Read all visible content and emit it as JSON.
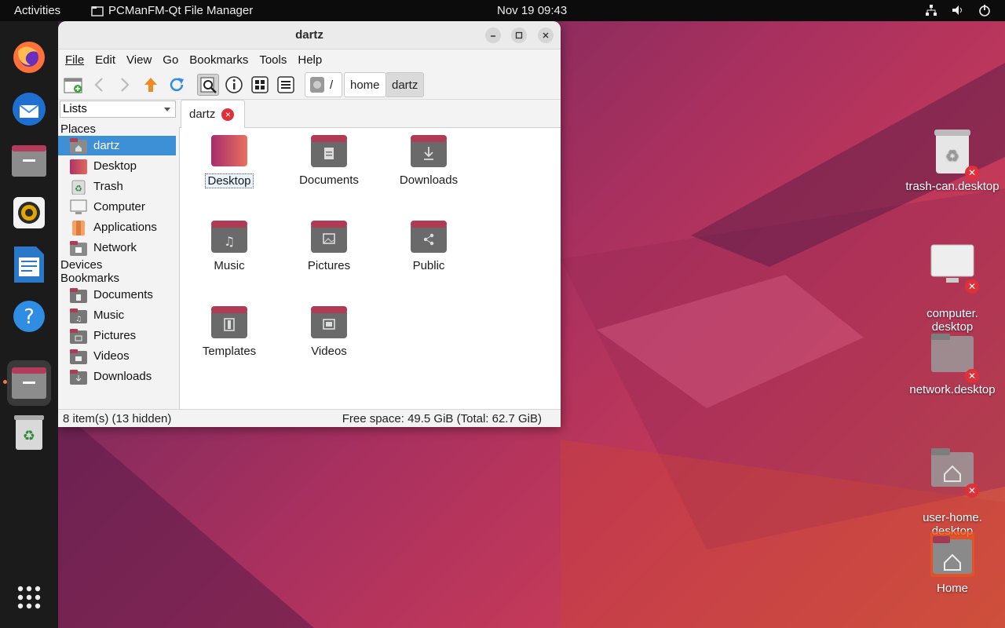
{
  "topbar": {
    "activities": "Activities",
    "app_name": "PCManFM-Qt File Manager",
    "clock": "Nov 19  09:43",
    "tray": [
      "network-icon",
      "volume-icon",
      "power-icon"
    ]
  },
  "dock": {
    "items": [
      {
        "name": "firefox",
        "icon": "firefox-icon"
      },
      {
        "name": "thunderbird",
        "icon": "thunderbird-icon"
      },
      {
        "name": "files",
        "icon": "files-icon"
      },
      {
        "name": "rhythmbox",
        "icon": "rhythmbox-icon"
      },
      {
        "name": "writer",
        "icon": "libreoffice-writer-icon"
      },
      {
        "name": "help",
        "icon": "help-icon"
      },
      {
        "name": "pcmanfm",
        "icon": "file-manager-icon",
        "active": true
      },
      {
        "name": "trash",
        "icon": "trash-icon"
      }
    ],
    "show_apps": "show-apps-icon"
  },
  "window": {
    "title": "dartz",
    "menu": [
      "File",
      "Edit",
      "View",
      "Go",
      "Bookmarks",
      "Tools",
      "Help"
    ],
    "breadcrumb": [
      "/",
      "home",
      "dartz"
    ],
    "sidebar": {
      "mode": "Lists",
      "places_header": "Places",
      "places": [
        "dartz",
        "Desktop",
        "Trash",
        "Computer",
        "Applications",
        "Network"
      ],
      "devices_header": "Devices",
      "bookmarks_header": "Bookmarks",
      "bookmarks": [
        "Documents",
        "Music",
        "Pictures",
        "Videos",
        "Downloads"
      ]
    },
    "tab": "dartz",
    "tab_close": "×",
    "files": [
      "Desktop",
      "Documents",
      "Downloads",
      "Music",
      "Pictures",
      "Public",
      "Templates",
      "Videos"
    ],
    "status_left": "8 item(s) (13 hidden)",
    "status_right": "Free space: 49.5 GiB (Total: 62.7 GiB)"
  },
  "desktop_icons": [
    {
      "label": "trash-can.desktop"
    },
    {
      "label": "computer.\ndesktop"
    },
    {
      "label": "network.desktop"
    },
    {
      "label": "user-home.\ndesktop"
    },
    {
      "label": "Home"
    }
  ],
  "colors": {
    "accent": "#e95420",
    "folder_tab": "#b03b55",
    "folder_body": "#666666",
    "selection": "#3d8fd6"
  }
}
